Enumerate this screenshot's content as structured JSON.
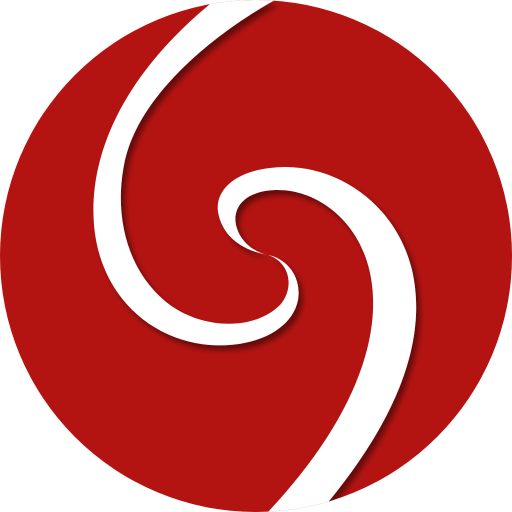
{
  "logo": {
    "icon": "red-swirl-logo-icon",
    "colors": {
      "disc": "#b31412",
      "disc_dark": "#9e0f0e",
      "swirl": "#ffffff",
      "background": "#ffffff"
    }
  }
}
